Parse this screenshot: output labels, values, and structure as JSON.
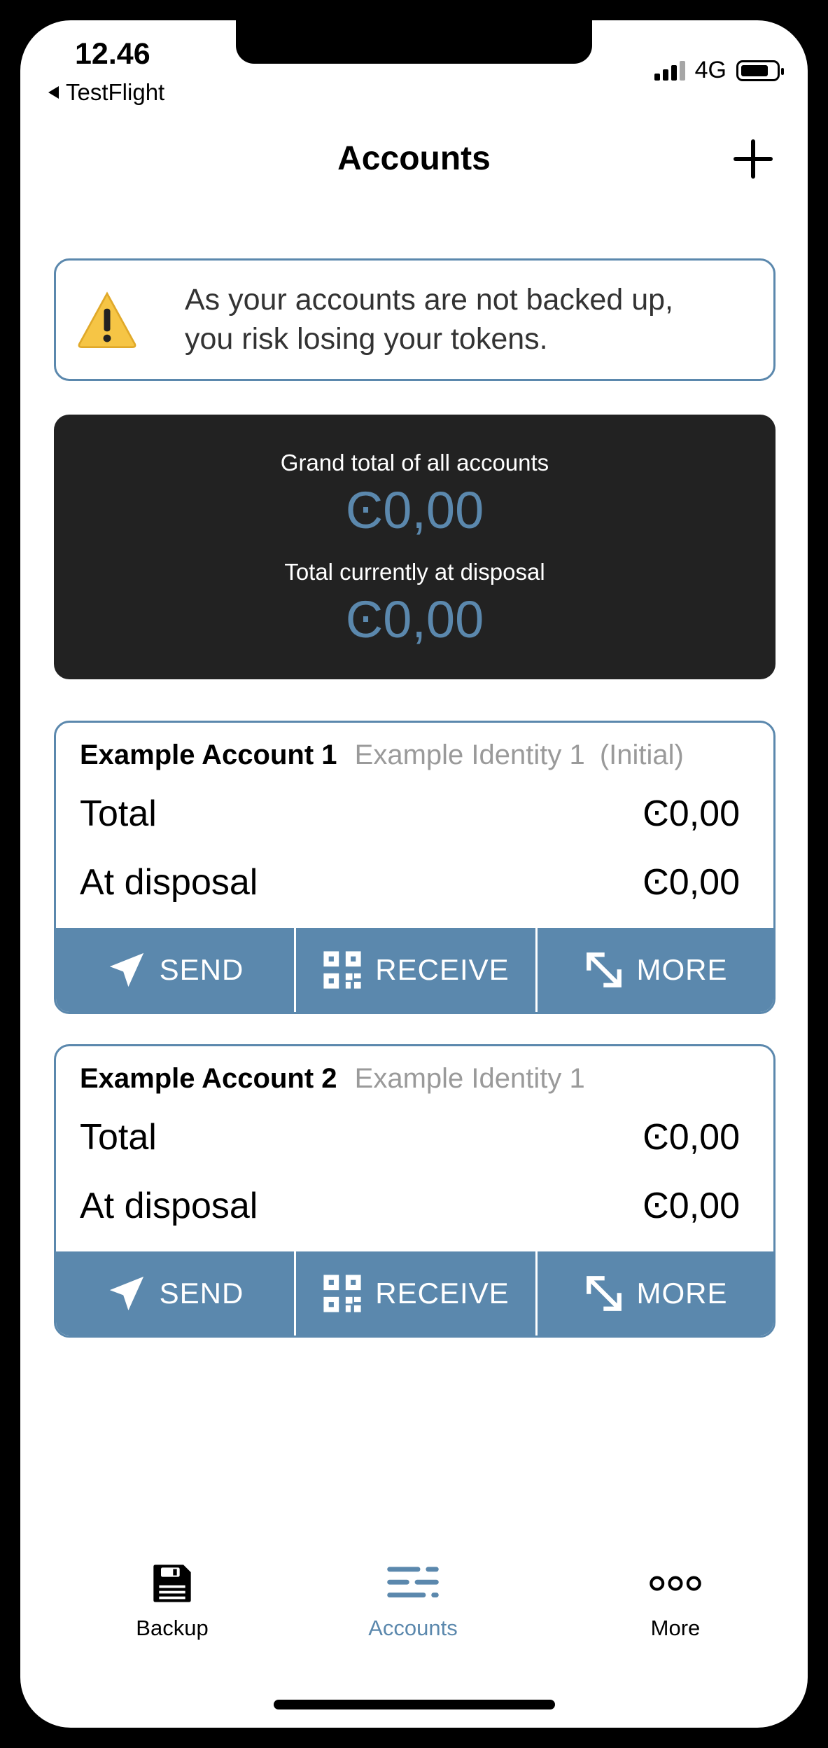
{
  "status_bar": {
    "time": "12.46",
    "back_app": "TestFlight",
    "network": "4G"
  },
  "header": {
    "title": "Accounts"
  },
  "warning": {
    "line1": "As your accounts are not backed up,",
    "line2": "you risk losing your tokens."
  },
  "totals": {
    "grand_total_label": "Grand total of all accounts",
    "grand_total_value": "Ͼ0,00",
    "disposal_label": "Total currently at disposal",
    "disposal_value": "Ͼ0,00"
  },
  "accounts": [
    {
      "name": "Example Account 1",
      "identity": "Example Identity 1",
      "tag": "(Initial)",
      "total_label": "Total",
      "total_value": "Ͼ0,00",
      "disposal_label": "At disposal",
      "disposal_value": "Ͼ0,00",
      "send_label": "SEND",
      "receive_label": "RECEIVE",
      "more_label": "MORE"
    },
    {
      "name": "Example Account 2",
      "identity": "Example Identity 1",
      "tag": "",
      "total_label": "Total",
      "total_value": "Ͼ0,00",
      "disposal_label": "At disposal",
      "disposal_value": "Ͼ0,00",
      "send_label": "SEND",
      "receive_label": "RECEIVE",
      "more_label": "MORE"
    }
  ],
  "tabs": [
    {
      "label": "Backup",
      "icon": "floppy-disk-icon",
      "active": false
    },
    {
      "label": "Accounts",
      "icon": "list-icon",
      "active": true
    },
    {
      "label": "More",
      "icon": "ellipsis-icon",
      "active": false
    }
  ],
  "colors": {
    "accent": "#5b88ad",
    "dark_panel": "#222222",
    "muted_text": "#9a9a9a"
  }
}
